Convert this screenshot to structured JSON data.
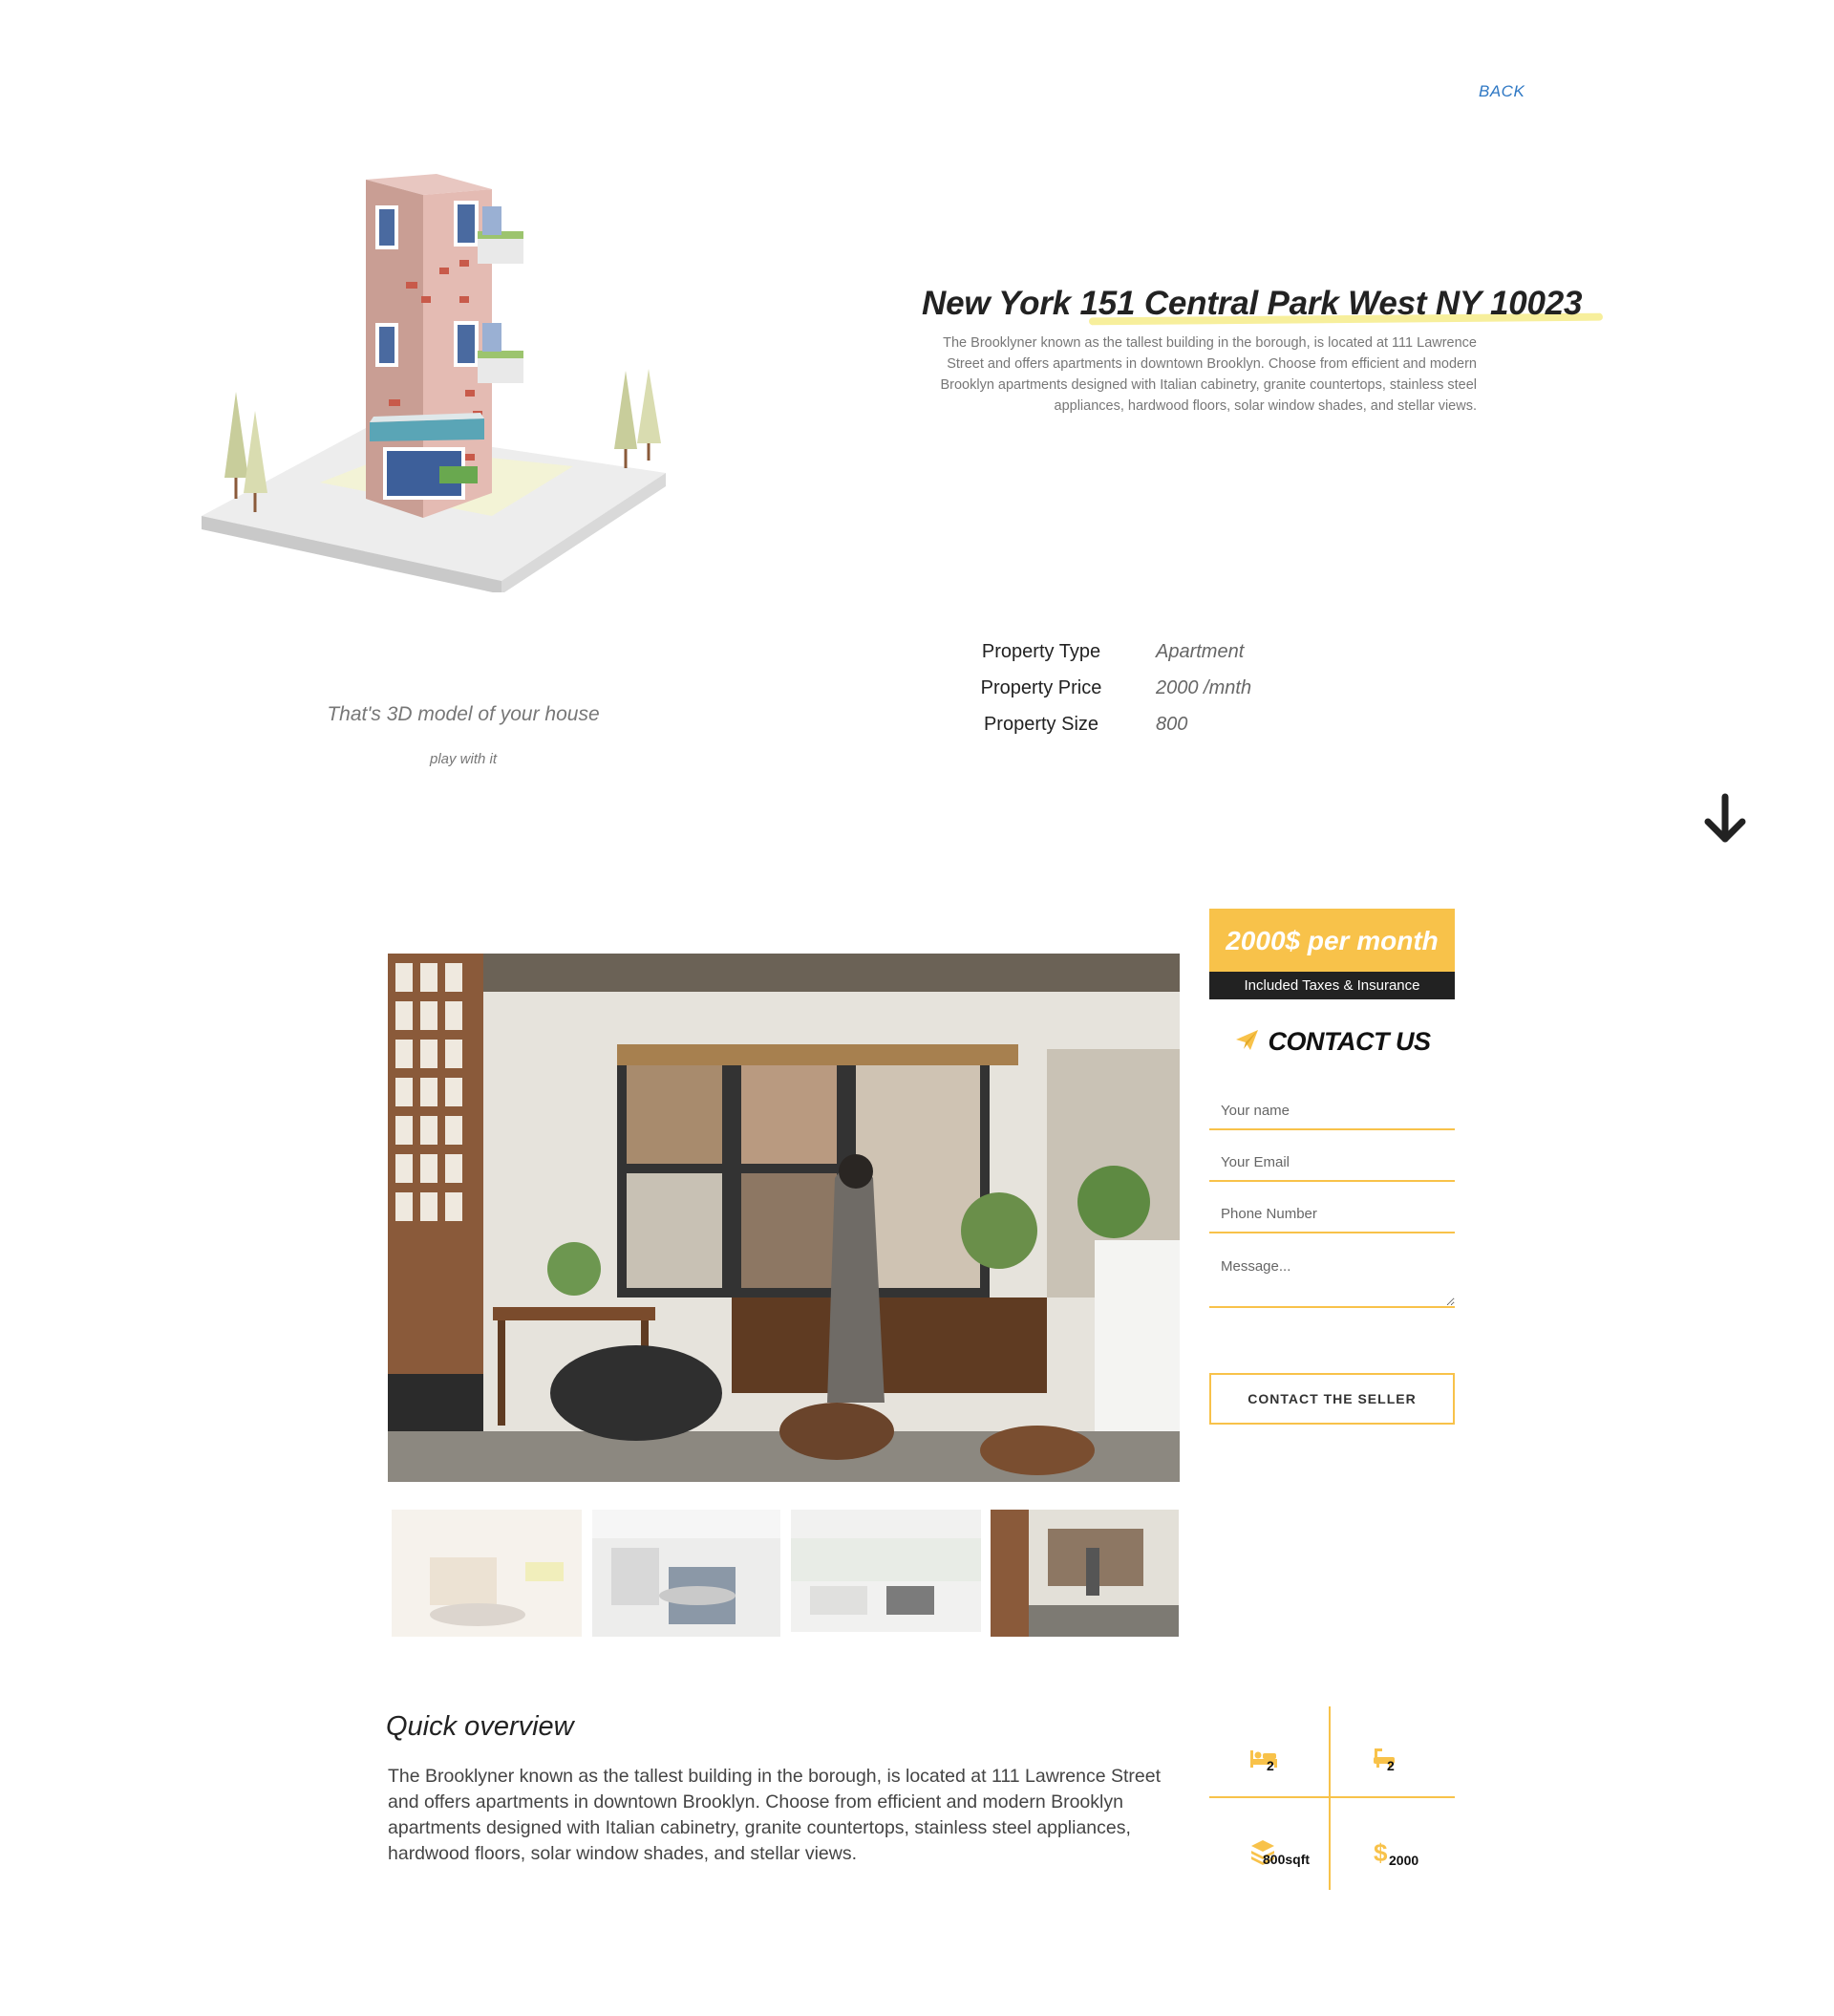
{
  "nav": {
    "back_label": "BACK"
  },
  "model": {
    "caption": "That's 3D model of your house",
    "subcaption": "play with it"
  },
  "property": {
    "title": "New York 151 Central Park West NY 10023",
    "description": "The Brooklyner known as the tallest building in the borough, is located at 111 Lawrence Street and offers apartments in downtown Brooklyn. Choose from efficient and modern Brooklyn apartments designed with Italian cabinetry, granite countertops, stainless steel appliances, hardwood floors, solar window shades, and stellar views.",
    "details": [
      {
        "label": "Property Type",
        "value": "Apartment"
      },
      {
        "label": "Property Price",
        "value": "2000 /mnth"
      },
      {
        "label": "Property Size",
        "value": "800"
      }
    ]
  },
  "pricing": {
    "price": "2000$ per month",
    "note": "Included Taxes & Insurance"
  },
  "contact": {
    "title": "CONTACT US",
    "fields": {
      "name_placeholder": "Your name",
      "email_placeholder": "Your Email",
      "phone_placeholder": "Phone Number",
      "message_placeholder": "Message..."
    },
    "submit_label": "CONTACT THE SELLER"
  },
  "overview": {
    "title": "Quick overview",
    "text": "The Brooklyner known as the tallest building in the borough, is located at 111 Lawrence Street and offers apartments in downtown Brooklyn. Choose from efficient and modern Brooklyn apartments designed with Italian cabinetry, granite countertops, stainless steel appliances, hardwood floors, solar window shades, and stellar views."
  },
  "stats": [
    {
      "icon": "bed-icon",
      "value": "2"
    },
    {
      "icon": "bath-icon",
      "value": "2"
    },
    {
      "icon": "area-layers-icon",
      "value": "800sqft"
    },
    {
      "icon": "dollar-icon",
      "value": "2000"
    }
  ],
  "colors": {
    "accent": "#f8c24a",
    "dark": "#222222",
    "link": "#2f78c4",
    "highlight": "#f7ef9c"
  }
}
